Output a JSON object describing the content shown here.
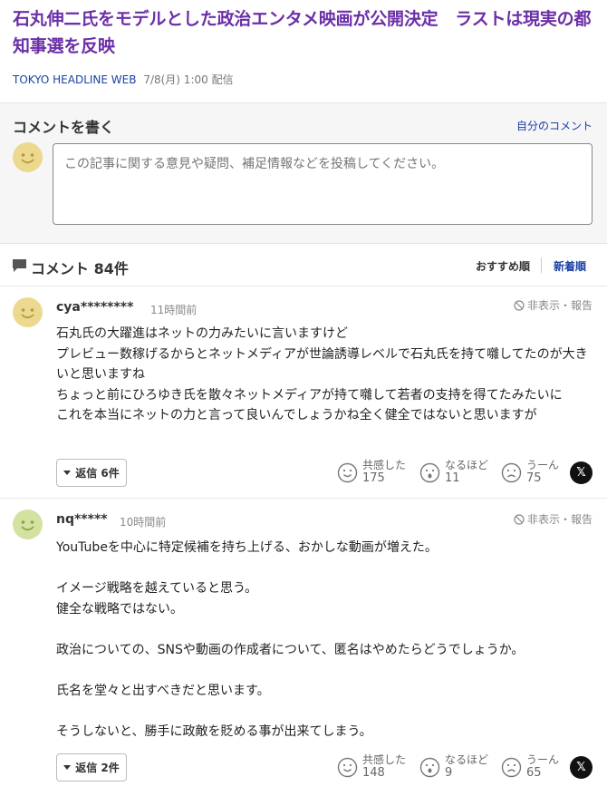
{
  "article": {
    "title": "石丸伸二氏をモデルとした政治エンタメ映画が公開決定　ラストは現実の都知事選を反映",
    "source": "TOKYO HEADLINE WEB",
    "date": "7/8(月) 1:00 配信"
  },
  "comment_form": {
    "heading": "コメントを書く",
    "my_comments_link": "自分のコメント",
    "placeholder": "この記事に関する意見や疑問、補足情報などを投稿してください。"
  },
  "comment_list": {
    "count_label": "コメント 84件",
    "sort_recommended": "おすすめ順",
    "sort_newest": "新着順"
  },
  "comments": [
    {
      "username": "cya********",
      "time": "11時間前",
      "report": "非表示・報告",
      "body": "石丸氏の大躍進はネットの力みたいに言いますけど\nプレビュー数稼げるからとネットメディアが世論誘導レベルで石丸氏を持て囃してたのが大きいと思いますね\nちょっと前にひろゆき氏を散々ネットメディアが持て囃して若者の支持を得てたみたいに\nこれを本当にネットの力と言って良いんでしょうかね全く健全ではないと思いますが",
      "reply_label": "返信 6件",
      "reactions": [
        {
          "label": "共感した",
          "count": "175"
        },
        {
          "label": "なるほど",
          "count": "11"
        },
        {
          "label": "うーん",
          "count": "75"
        }
      ],
      "avatar_color": "#ecd98f"
    },
    {
      "username": "nq*****",
      "time": "10時間前",
      "report": "非表示・報告",
      "body": "YouTubeを中心に特定候補を持ち上げる、おかしな動画が増えた。\n\nイメージ戦略を越えていると思う。\n健全な戦略ではない。\n\n政治についての、SNSや動画の作成者について、匿名はやめたらどうでしょうか。\n\n氏名を堂々と出すべきだと思います。\n\nそうしないと、勝手に政敵を貶める事が出来てしまう。",
      "reply_label": "返信 2件",
      "reactions": [
        {
          "label": "共感した",
          "count": "148"
        },
        {
          "label": "なるほど",
          "count": "9"
        },
        {
          "label": "うーん",
          "count": "65"
        }
      ],
      "avatar_color": "#d3e2a0"
    }
  ],
  "icons": {
    "share": "x-logo-icon",
    "reactions": [
      "smile-icon",
      "surprised-icon",
      "frown-icon"
    ]
  }
}
